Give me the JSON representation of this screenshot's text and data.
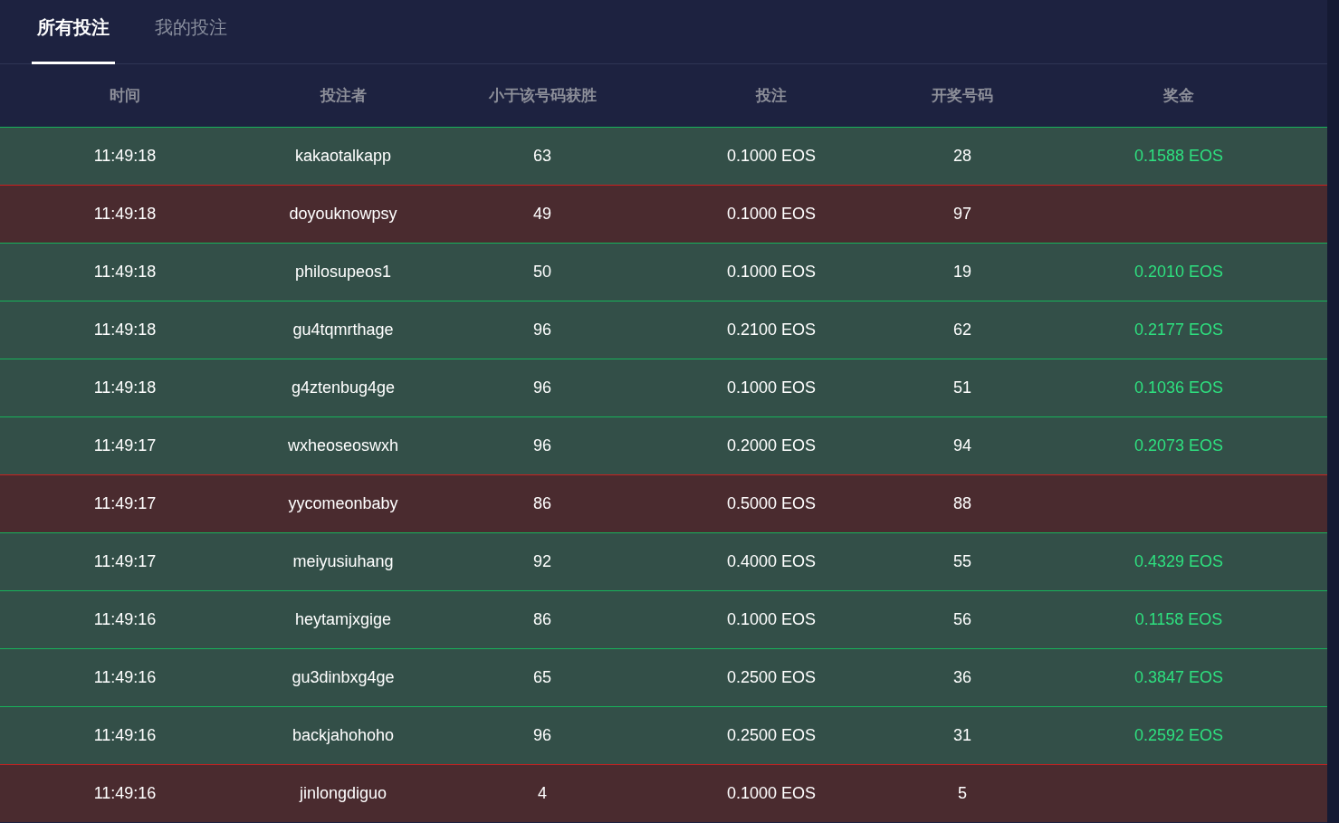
{
  "tabs": [
    {
      "label": "所有投注",
      "selected": true
    },
    {
      "label": "我的投注",
      "selected": false
    }
  ],
  "table": {
    "columns": [
      "时间",
      "投注者",
      "小于该号码获胜",
      "投注",
      "开奖号码",
      "奖金"
    ],
    "rows": [
      {
        "kind": "win",
        "time": "11:49:18",
        "player": "kakaotalkapp",
        "under": "63",
        "bet": "0.1000 EOS",
        "roll": "28",
        "payout": "0.1588 EOS"
      },
      {
        "kind": "loss",
        "time": "11:49:18",
        "player": "doyouknowpsy",
        "under": "49",
        "bet": "0.1000 EOS",
        "roll": "97"
      },
      {
        "kind": "win",
        "time": "11:49:18",
        "player": "philosupeos1",
        "under": "50",
        "bet": "0.1000 EOS",
        "roll": "19",
        "payout": "0.2010 EOS"
      },
      {
        "kind": "win",
        "time": "11:49:18",
        "player": "gu4tqmrthage",
        "under": "96",
        "bet": "0.2100 EOS",
        "roll": "62",
        "payout": "0.2177 EOS"
      },
      {
        "kind": "win",
        "time": "11:49:18",
        "player": "g4ztenbug4ge",
        "under": "96",
        "bet": "0.1000 EOS",
        "roll": "51",
        "payout": "0.1036 EOS"
      },
      {
        "kind": "win",
        "time": "11:49:17",
        "player": "wxheoseoswxh",
        "under": "96",
        "bet": "0.2000 EOS",
        "roll": "94",
        "payout": "0.2073 EOS"
      },
      {
        "kind": "loss",
        "time": "11:49:17",
        "player": "yycomeonbaby",
        "under": "86",
        "bet": "0.5000 EOS",
        "roll": "88"
      },
      {
        "kind": "win",
        "time": "11:49:17",
        "player": "meiyusiuhang",
        "under": "92",
        "bet": "0.4000 EOS",
        "roll": "55",
        "payout": "0.4329 EOS"
      },
      {
        "kind": "win",
        "time": "11:49:16",
        "player": "heytamjxgige",
        "under": "86",
        "bet": "0.1000 EOS",
        "roll": "56",
        "payout": "0.1158 EOS"
      },
      {
        "kind": "win",
        "time": "11:49:16",
        "player": "gu3dinbxg4ge",
        "under": "65",
        "bet": "0.2500 EOS",
        "roll": "36",
        "payout": "0.3847 EOS"
      },
      {
        "kind": "win",
        "time": "11:49:16",
        "player": "backjahohoho",
        "under": "96",
        "bet": "0.2500 EOS",
        "roll": "31",
        "payout": "0.2592 EOS"
      },
      {
        "kind": "loss",
        "time": "11:49:16",
        "player": "jinlongdiguo",
        "under": "4",
        "bet": "0.1000 EOS",
        "roll": "5"
      }
    ]
  }
}
